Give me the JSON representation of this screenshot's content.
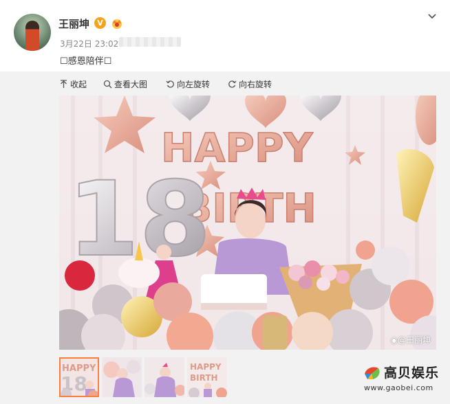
{
  "post": {
    "author": "王丽坤",
    "verified_badge": "V",
    "date": "3月22日 23:02",
    "text": "☐感恩陪伴☐"
  },
  "toolbar": {
    "collapse": "收起",
    "view_large": "查看大图",
    "rotate_left": "向左旋转",
    "rotate_right": "向右旋转"
  },
  "photo": {
    "balloon_letters": "HAPPY BIRTH",
    "number": "18",
    "watermark": "@王丽坤"
  },
  "thumbnails": {
    "count": 4,
    "selected": 1
  },
  "brand": {
    "name": "高贝娱乐",
    "site": "www.gaobei.com"
  },
  "icons": [
    "avatar",
    "verified-icon",
    "crown-icon",
    "chevron-down-icon",
    "collapse-icon",
    "search-icon",
    "rotate-left-icon",
    "rotate-right-icon",
    "weibo-icon"
  ],
  "colors": {
    "accent": "#fa7d3c",
    "badge": "#f7a21b",
    "rose_gold": "#e6a596",
    "silver": "#d9d4d8"
  }
}
